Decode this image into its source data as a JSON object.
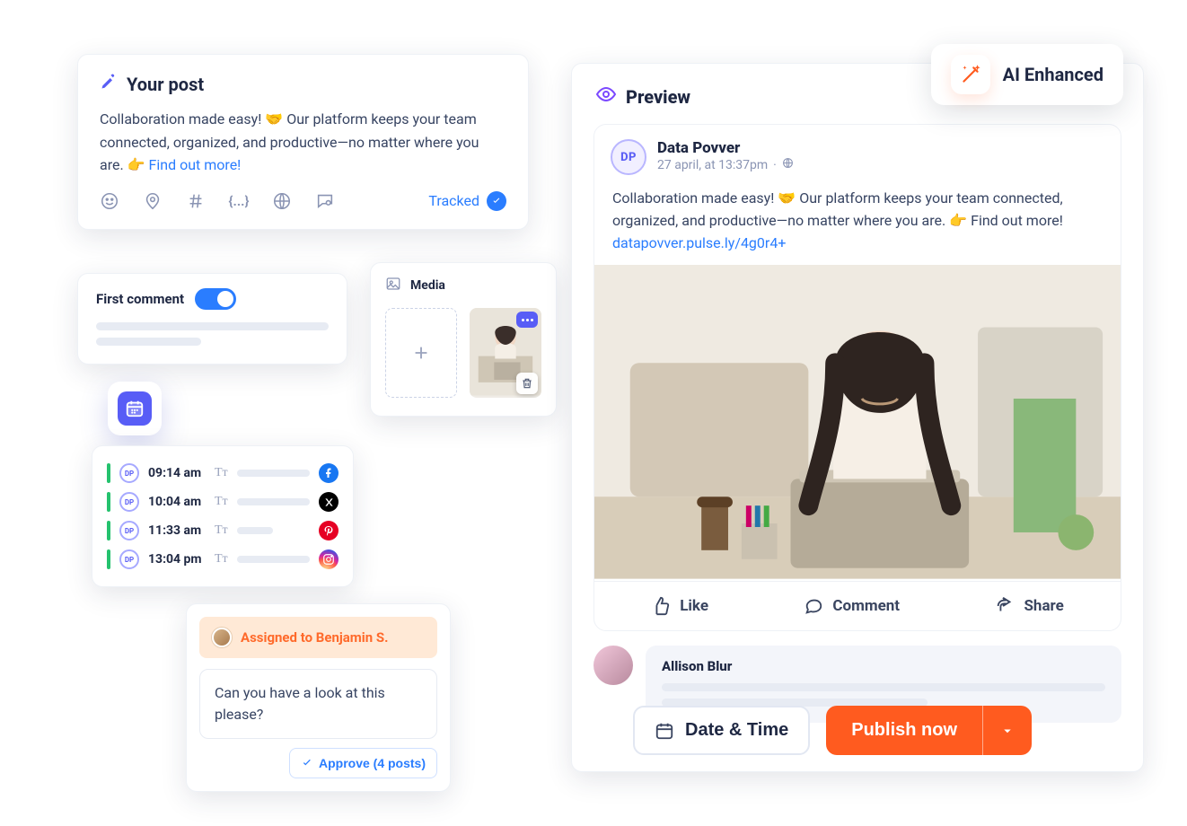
{
  "post": {
    "title": "Your post",
    "body_a": "Collaboration made easy! ",
    "body_b": " Our platform keeps your team connected, organized, and productive—no matter where you are. ",
    "link": "Find out more!",
    "tracked": "Tracked"
  },
  "first_comment": {
    "label": "First comment"
  },
  "schedule": {
    "items": [
      {
        "time": "09:14 am",
        "network": "facebook"
      },
      {
        "time": "10:04 am",
        "network": "x"
      },
      {
        "time": "11:33 am",
        "network": "pinterest"
      },
      {
        "time": "13:04 pm",
        "network": "instagram"
      }
    ]
  },
  "assigned": {
    "to": "Assigned to Benjamin S.",
    "message": "Can you have a look at this please?",
    "approve": "Approve (4 posts)"
  },
  "media": {
    "title": "Media"
  },
  "preview": {
    "ai_badge": "AI Enhanced",
    "title": "Preview",
    "account": {
      "initials": "DP",
      "name": "Data Povver",
      "sub": "27 april, at 13:37pm"
    },
    "body_a": "Collaboration made easy! ",
    "body_b": " Our platform keeps your team connected, organized, and productive—no matter where you are. ",
    "body_c": " Find out more!",
    "short_link": "datapovver.pulse.ly/4g0r4+",
    "actions": {
      "like": "Like",
      "comment": "Comment",
      "share": "Share"
    },
    "comment_author": "Allison Blur",
    "datetime_btn": "Date & Time",
    "publish_btn": "Publish now"
  }
}
